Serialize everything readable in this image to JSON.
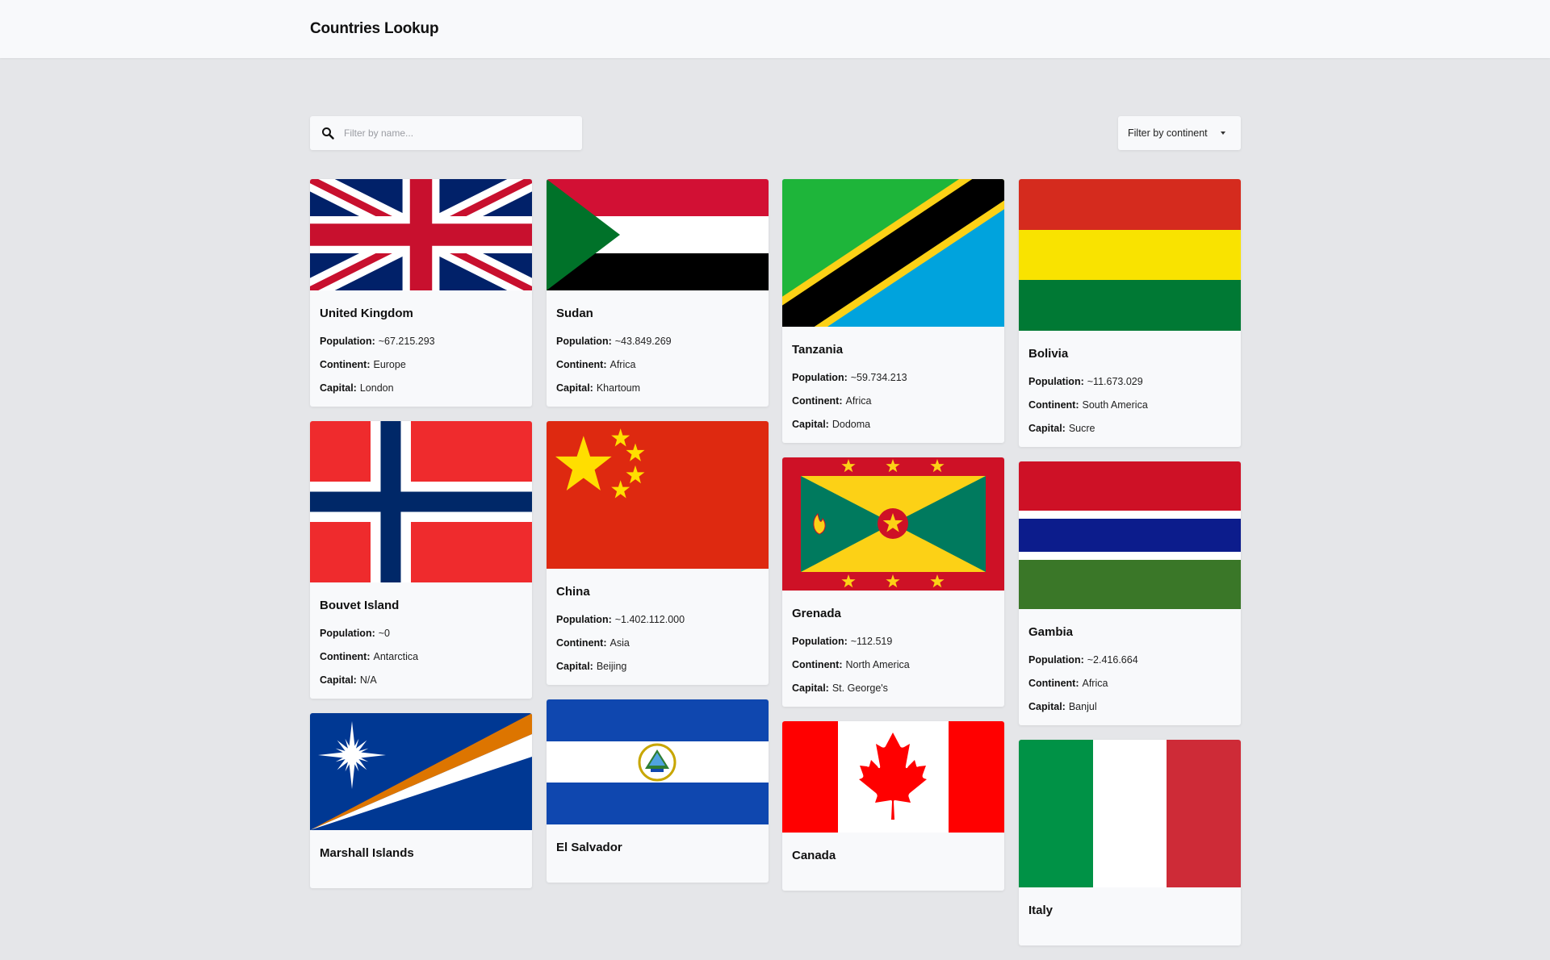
{
  "app": {
    "title": "Countries Lookup"
  },
  "search": {
    "placeholder": "Filter by name..."
  },
  "filter": {
    "label": "Filter by continent"
  },
  "labels": {
    "population": "Population:",
    "continent": "Continent:",
    "capital": "Capital:"
  },
  "countries": [
    {
      "name": "United Kingdom",
      "population": "~67.215.293",
      "continent": "Europe",
      "capital": "London"
    },
    {
      "name": "Sudan",
      "population": "~43.849.269",
      "continent": "Africa",
      "capital": "Khartoum"
    },
    {
      "name": "Tanzania",
      "population": "~59.734.213",
      "continent": "Africa",
      "capital": "Dodoma"
    },
    {
      "name": "Bolivia",
      "population": "~11.673.029",
      "continent": "South America",
      "capital": "Sucre"
    },
    {
      "name": "Bouvet Island",
      "population": "~0",
      "continent": "Antarctica",
      "capital": "N/A"
    },
    {
      "name": "China",
      "population": "~1.402.112.000",
      "continent": "Asia",
      "capital": "Beijing"
    },
    {
      "name": "Grenada",
      "population": "~112.519",
      "continent": "North America",
      "capital": "St. George's"
    },
    {
      "name": "Gambia",
      "population": "~2.416.664",
      "continent": "Africa",
      "capital": "Banjul"
    },
    {
      "name": "Marshall Islands"
    },
    {
      "name": "El Salvador"
    },
    {
      "name": "Canada"
    },
    {
      "name": "Italy"
    }
  ]
}
